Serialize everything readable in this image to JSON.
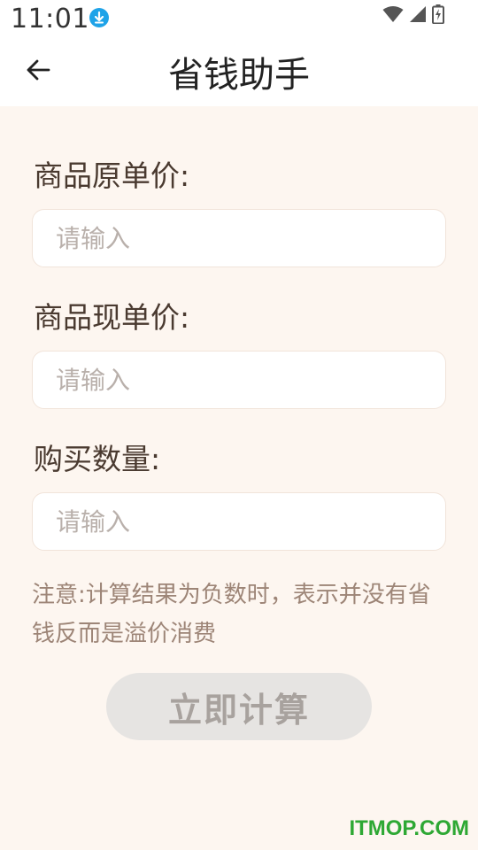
{
  "status_bar": {
    "time": "11:01"
  },
  "app_bar": {
    "title": "省钱助手"
  },
  "form": {
    "original_price_label": "商品原单价:",
    "original_price_placeholder": "请输入",
    "current_price_label": "商品现单价:",
    "current_price_placeholder": "请输入",
    "quantity_label": "购买数量:",
    "quantity_placeholder": "请输入"
  },
  "note": "注意:计算结果为负数时，表示并没有省钱反而是溢价消费",
  "calculate_button_label": "立即计算",
  "watermark": "ITMOP.COM",
  "colors": {
    "background": "#fdf6f0",
    "label_text": "#4a3a30",
    "note_text": "#9d8577",
    "button_bg": "#e6e4e2",
    "button_text": "#a8a29e",
    "download_icon": "#1fa3e8",
    "watermark": "#2ea834"
  }
}
